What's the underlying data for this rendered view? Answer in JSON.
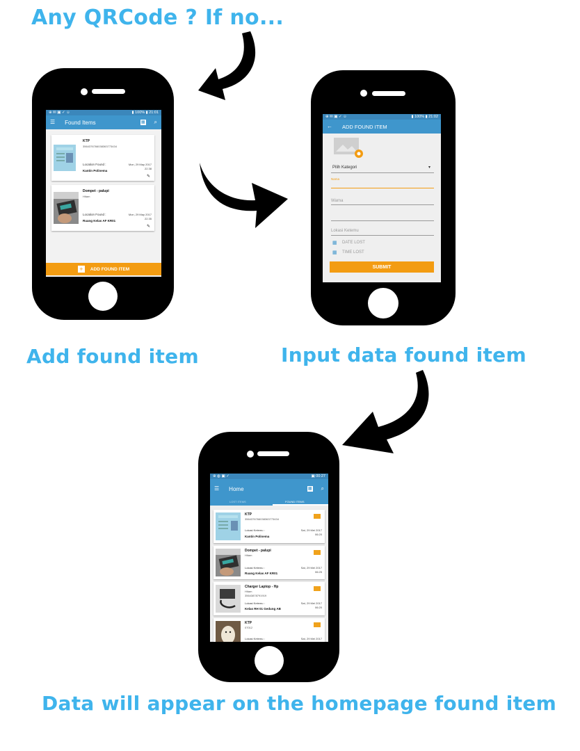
{
  "captions": {
    "top": "Any QRCode ? If no...",
    "left": "Add found item",
    "right": "Input data found item",
    "bottom": "Data will appear on the homepage found item"
  },
  "colors": {
    "caption": "#3fb4ec",
    "appbar": "#3f96cc",
    "accent": "#f39c12"
  },
  "phone1": {
    "status_left": "⊕ ✉ ▣ ✓ ☺",
    "status_right": "▮ 100% ▮ 21:01",
    "title": "Found Items",
    "items": [
      {
        "title": "KTP",
        "subtitle": "3564376766038363773434",
        "location_label": "Location Found :",
        "date": "Mon, 29 May 2017",
        "time": "22.38",
        "place": "Kantin Polinema"
      },
      {
        "title": "Dompet - palupi",
        "subtitle": "Hitam",
        "location_label": "Location Found :",
        "date": "Mon, 29 May 2017",
        "time": "22.35",
        "place": "Ruang Kelas AF KR01"
      }
    ],
    "add_button": "ADD FOUND ITEM"
  },
  "phone2": {
    "status_left": "⊕ ✉ ▣ ✓ ☺",
    "status_right": "▮ 100% ▮ 21:02",
    "title": "ADD FOUND ITEM",
    "category_placeholder": "Pilih Kategori",
    "name_label": "Nama",
    "color_placeholder": "Warna",
    "location_placeholder": "Lokasi Ketemu",
    "date_label": "DATE LOST",
    "time_label": "TIME LOST",
    "submit": "SUBMIT"
  },
  "phone3": {
    "status_left": "⊕ ◍ ▣ ✓",
    "status_right": "▣ 00:27",
    "title": "Home",
    "tab_lost": "LOST ITEMS",
    "tab_found": "FOUND ITEMS",
    "items": [
      {
        "title": "KTP",
        "subtitle": "3564376766038363773434",
        "location_label": "Lokasi Ketemu :",
        "date": "Sat, 29 Mei 2017",
        "time": "06:20",
        "place": "Kantin Polinema"
      },
      {
        "title": "Dompet - palupi",
        "subtitle": "Hitam",
        "location_label": "Lokasi Ketemu :",
        "date": "Sat, 29 Mei 2017",
        "time": "06:25",
        "place": "Ruang Kelas AF KR01"
      },
      {
        "title": "Charger Laptop - Hp",
        "subtitle": "Hitam",
        "location_label": "Lokasi Ketemu :",
        "date": "Sat, 29 Mei 2017",
        "time": "06:20",
        "place": "Kelas RH 01 Gedung AB",
        "code": "35643878791919"
      },
      {
        "title": "KTP",
        "subtitle": "07012",
        "location_label": "Lokasi Ketemu :",
        "date": "Sat, 29 Mei 2017",
        "time": "",
        "place": ""
      }
    ]
  }
}
